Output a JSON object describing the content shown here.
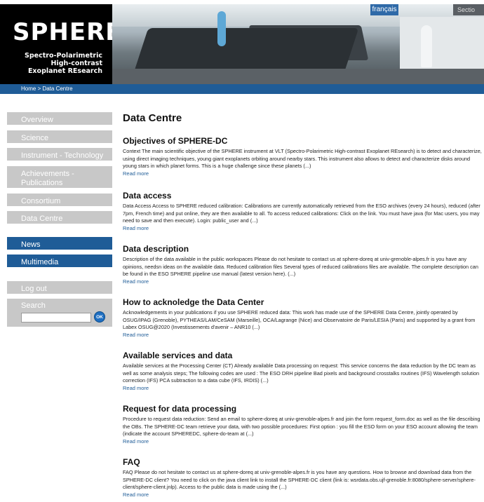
{
  "header": {
    "logo": {
      "word": "SPHERE",
      "line1": "Spectro-Polarimetric",
      "line2": "High-contrast",
      "line3": "Exoplanet REsearch"
    },
    "language_link": "français",
    "section_label": "Sectio"
  },
  "breadcrumb": "Home > Data Centre",
  "sidebar": {
    "items": [
      {
        "label": "Overview"
      },
      {
        "label": "Science"
      },
      {
        "label": "Instrument - Technology"
      },
      {
        "label": "Achievements - Publications"
      },
      {
        "label": "Consortium"
      },
      {
        "label": "Data Centre"
      },
      {
        "label": "News"
      },
      {
        "label": "Multimedia"
      },
      {
        "label": "Log out"
      }
    ],
    "search": {
      "label": "Search",
      "value": "",
      "button": "OK"
    }
  },
  "main": {
    "title": "Data Centre",
    "read_more": "Read more",
    "articles": [
      {
        "title": "Objectives of SPHERE-DC",
        "body": "Context The main scientific objective of the SPHERE instrument at VLT (Spectro-Polarimetric High-contrast Exoplanet REsearch) is to detect and characterize, using direct imaging techniques, young giant exoplanets orbiting around nearby stars. This instrument also allows to detect and characterize disks around young stars in which planet forms. This is a huge challenge since these planets (...)"
      },
      {
        "title": "Data access",
        "body": "Data Access Access to SPHERE reduced calibration: Calibrations are currently automatically retrieved from the ESO archives (every 24 hours), reduced (after 7pm, French time) and put online, they are then available to all. To access reduced calibrations: Click on the link. You must have java (for Mac users, you may need to save and then execute). Login: public_user and (...)"
      },
      {
        "title": "Data description",
        "body": "Description of the data available in the public workspaces Please do not hesitate to contact us at sphere-doreq at univ-grenoble-alpes.fr is you have any opinions, needsn ideas on the available data. Reduced calibration files Several types of reduced calibrations files are available. The complete description can be found in the ESO SPHERE pipeline use manual (latest version here). (...)"
      },
      {
        "title": "How to acknoledge the Data Center",
        "body": "Acknowledgements in your publications if you use SPHERE reduced data: This work has made use of the SPHERE Data Centre, jointly operated by OSUG/IPAG (Grenoble), PYTHEAS/LAM/CeSAM (Marseille), OCA/Lagrange (Nice) and Observatoire de Paris/LESIA (Paris) and supported by a grant from Labex OSUG@2020 (Investissements d'avenir – ANR10 (...)"
      },
      {
        "title": "Available services and data",
        "body": "Available services at the Processing Center (CT) Already available Data processing on request: This service concerns the data reduction by the DC team as well as some analysis steps; The following codes are used : The ESO DRH pipeline Bad pixels and background crosstalks routines (IFS) Wavelength solution correction (IFS) PCA subtraction to a data cube (IFS, IRDIS) (...)"
      },
      {
        "title": "Request for data processing",
        "body": "Procedure to request data reduction: Send an email to sphere-doreq at univ-grenoble-alpes.fr and join the form request_form.doc as well as the file describing the OBs. The SPHERE-DC team retrieve your data, with two possible procedures: First option : you fill the ESO form on your ESO account allowing the team (indicate the account SPHEREDC, sphere-do-team at (...)"
      },
      {
        "title": "FAQ",
        "body": "FAQ Please do not hesitate to contact us at sphere-doreq at univ-grenoble-alpes.fr is you have any questions. How to browse and download data from the SPHERE-DC client? You need to click on the java client link to install the SPHERE-DC client (link is: wsrdata.obs.ujf-grenoble.fr:8080/sphere-server/sphere-client/sphere-client.jnlp). Access to the public data is made using the (...)"
      }
    ]
  },
  "colors": {
    "brand_blue": "#1f5c97",
    "nav_gray": "#c8c8c8",
    "header_black": "#000000"
  }
}
